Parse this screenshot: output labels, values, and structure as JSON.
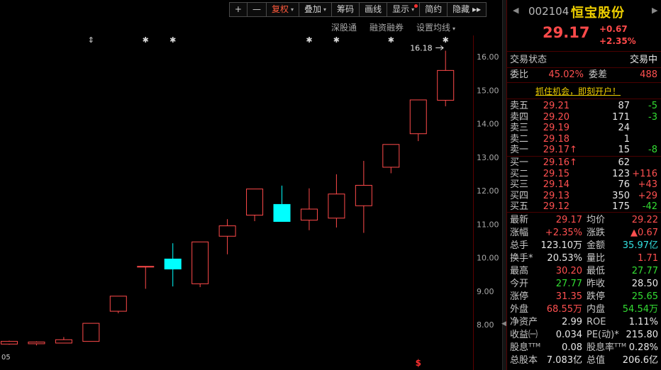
{
  "toolbar": {
    "items": [
      {
        "label": "+",
        "name": "zoom-in-button",
        "active": false,
        "caret": false,
        "dot": false
      },
      {
        "label": "—",
        "name": "zoom-out-button",
        "active": false,
        "caret": false,
        "dot": false
      },
      {
        "label": "复权",
        "name": "fuquan-button",
        "active": true,
        "caret": true,
        "dot": false
      },
      {
        "label": "叠加",
        "name": "overlay-button",
        "active": false,
        "caret": true,
        "dot": false
      },
      {
        "label": "筹码",
        "name": "chips-button",
        "active": false,
        "caret": false,
        "dot": false
      },
      {
        "label": "画线",
        "name": "draw-line-button",
        "active": false,
        "caret": false,
        "dot": false
      },
      {
        "label": "显示",
        "name": "display-button",
        "active": false,
        "caret": true,
        "dot": true
      },
      {
        "label": "简约",
        "name": "simple-button",
        "active": false,
        "caret": false,
        "dot": false
      },
      {
        "label": "隐藏 ▸▸",
        "name": "hide-button",
        "active": false,
        "caret": false,
        "dot": false
      }
    ]
  },
  "subbar": {
    "shengutong": "深股通",
    "margin": "融资融券",
    "ma_settings": "设置均线"
  },
  "chart_data": {
    "type": "candlestick",
    "ylim": [
      7.3,
      16.8
    ],
    "yticks": [
      "16.00",
      "15.00",
      "14.00",
      "13.00",
      "12.00",
      "11.00",
      "10.00",
      "9.00",
      "8.00"
    ],
    "ytick_values": [
      16,
      15,
      14,
      13,
      12,
      11,
      10,
      9,
      8
    ],
    "max_label": "16.18",
    "date_fragment": "05",
    "candles": [
      {
        "o": 7.42,
        "c": 7.5,
        "h": 7.52,
        "l": 7.4,
        "up": true
      },
      {
        "o": 7.43,
        "c": 7.48,
        "h": 7.5,
        "l": 7.38,
        "up": true
      },
      {
        "o": 7.45,
        "c": 7.55,
        "h": 7.63,
        "l": 7.44,
        "up": true
      },
      {
        "o": 7.5,
        "c": 8.04,
        "h": 8.04,
        "l": 7.5,
        "up": true
      },
      {
        "o": 8.4,
        "c": 8.85,
        "h": 8.85,
        "l": 8.34,
        "up": true
      },
      {
        "o": 9.74,
        "c": 9.74,
        "h": 9.74,
        "l": 9.07,
        "up": true
      },
      {
        "o": 9.97,
        "c": 9.65,
        "h": 10.43,
        "l": 9.14,
        "up": false
      },
      {
        "o": 9.22,
        "c": 10.47,
        "h": 10.47,
        "l": 9.12,
        "up": true
      },
      {
        "o": 10.64,
        "c": 10.95,
        "h": 11.15,
        "l": 10.1,
        "up": true
      },
      {
        "o": 11.27,
        "c": 12.05,
        "h": 12.05,
        "l": 11.09,
        "up": true
      },
      {
        "o": 11.6,
        "c": 11.07,
        "h": 12.15,
        "l": 11.07,
        "up": false
      },
      {
        "o": 11.12,
        "c": 11.45,
        "h": 12.07,
        "l": 10.82,
        "up": true
      },
      {
        "o": 11.18,
        "c": 11.9,
        "h": 12.49,
        "l": 10.9,
        "up": true
      },
      {
        "o": 11.55,
        "c": 12.16,
        "h": 12.89,
        "l": 10.74,
        "up": true
      },
      {
        "o": 12.7,
        "c": 13.38,
        "h": 13.38,
        "l": 12.52,
        "up": true
      },
      {
        "o": 13.7,
        "c": 14.71,
        "h": 14.71,
        "l": 13.48,
        "up": true
      },
      {
        "o": 14.7,
        "c": 15.59,
        "h": 16.18,
        "l": 14.52,
        "up": true
      }
    ],
    "markers": [
      {
        "i": 3,
        "sym": "⇕"
      },
      {
        "i": 5,
        "sym": "✱"
      },
      {
        "i": 6,
        "sym": "✱"
      },
      {
        "i": 11,
        "sym": "✱"
      },
      {
        "i": 12,
        "sym": "✱"
      },
      {
        "i": 14,
        "sym": "✱"
      },
      {
        "i": 16,
        "sym": "✱"
      }
    ],
    "bottom_marker": {
      "i": 15,
      "sym": "$"
    },
    "colors": {
      "up": "#ff4a4a",
      "down": "#00ffff",
      "axis_text": "#a8a8a8",
      "marker": "#d8d8d8"
    }
  },
  "stock": {
    "code": "002104",
    "name": "恒宝股份",
    "price": "29.17",
    "change": "+0.67",
    "change_pct": "+2.35%"
  },
  "status": {
    "label": "交易状态",
    "value": "交易中"
  },
  "weibi": {
    "label": "委比",
    "value": "45.02%",
    "diff_label": "委差",
    "diff_value": "488"
  },
  "promo": "抓住机会，即刻开户！",
  "sells": [
    {
      "label": "卖五",
      "price": "29.21",
      "vol": "87",
      "delta": "-5",
      "arrow": ""
    },
    {
      "label": "卖四",
      "price": "29.20",
      "vol": "171",
      "delta": "-3",
      "arrow": ""
    },
    {
      "label": "卖三",
      "price": "29.19",
      "vol": "24",
      "delta": "",
      "arrow": ""
    },
    {
      "label": "卖二",
      "price": "29.18",
      "vol": "1",
      "delta": "",
      "arrow": ""
    },
    {
      "label": "卖一",
      "price": "29.17",
      "vol": "15",
      "delta": "-8",
      "arrow": "↑"
    }
  ],
  "buys": [
    {
      "label": "买一",
      "price": "29.16",
      "vol": "62",
      "delta": "",
      "arrow": "↑"
    },
    {
      "label": "买二",
      "price": "29.15",
      "vol": "123",
      "delta": "+116",
      "arrow": ""
    },
    {
      "label": "买三",
      "price": "29.14",
      "vol": "76",
      "delta": "+43",
      "arrow": ""
    },
    {
      "label": "买四",
      "price": "29.13",
      "vol": "350",
      "delta": "+29",
      "arrow": ""
    },
    {
      "label": "买五",
      "price": "29.12",
      "vol": "175",
      "delta": "-42",
      "arrow": ""
    }
  ],
  "stats": [
    {
      "l1": "最新",
      "v1": "29.17",
      "c1": "red",
      "l2": "均价",
      "v2": "29.22",
      "c2": "red"
    },
    {
      "l1": "涨幅",
      "v1": "+2.35%",
      "c1": "red",
      "l2": "涨跌",
      "v2": "▲0.67",
      "c2": "red"
    },
    {
      "l1": "总手",
      "v1": "123.10万",
      "c1": "white",
      "l2": "金额",
      "v2": "35.97亿",
      "c2": "cyan"
    },
    {
      "l1": "换手*",
      "v1": "20.53%",
      "c1": "white",
      "l2": "量比",
      "v2": "1.71",
      "c2": "red"
    },
    {
      "l1": "最高",
      "v1": "30.20",
      "c1": "red",
      "l2": "最低",
      "v2": "27.77",
      "c2": "green"
    },
    {
      "l1": "今开",
      "v1": "27.77",
      "c1": "green",
      "l2": "昨收",
      "v2": "28.50",
      "c2": "white"
    },
    {
      "l1": "涨停",
      "v1": "31.35",
      "c1": "red",
      "l2": "跌停",
      "v2": "25.65",
      "c2": "green"
    },
    {
      "l1": "外盘",
      "v1": "68.55万",
      "c1": "red",
      "l2": "内盘",
      "v2": "54.54万",
      "c2": "green"
    },
    {
      "l1": "净资产",
      "v1": "2.99",
      "c1": "white",
      "l2": "ROE",
      "v2": "1.11%",
      "c2": "white"
    },
    {
      "l1": "收益㈠",
      "v1": "0.034",
      "c1": "white",
      "l2": "PE(动)*",
      "v2": "215.80",
      "c2": "white"
    },
    {
      "l1": "股息ᵀᵀᴹ",
      "v1": "0.08",
      "c1": "white",
      "l2": "股息率ᵀᵀᴹ",
      "v2": "0.28%",
      "c2": "white"
    },
    {
      "l1": "总股本",
      "v1": "7.083亿",
      "c1": "white",
      "l2": "总值",
      "v2": "206.6亿",
      "c2": "white"
    }
  ]
}
